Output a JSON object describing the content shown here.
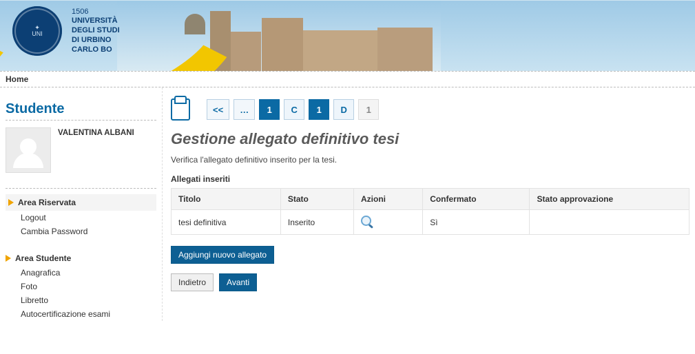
{
  "university": {
    "year": "1506",
    "line1": "UNIVERSITÀ",
    "line2": "DEGLI STUDI",
    "line3": "DI URBINO",
    "line4": "CARLO BO"
  },
  "breadcrumb": {
    "home": "Home"
  },
  "sidebar": {
    "title": "Studente",
    "user_name": "VALENTINA ALBANI",
    "area_riservata": {
      "label": "Area Riservata",
      "items": [
        "Logout",
        "Cambia Password"
      ]
    },
    "area_studente": {
      "label": "Area Studente",
      "items": [
        "Anagrafica",
        "Foto",
        "Libretto",
        "Autocertificazione esami"
      ]
    }
  },
  "wizard": {
    "back": "<<",
    "dots": "…",
    "steps": [
      "1",
      "C",
      "1",
      "D",
      "1"
    ]
  },
  "page": {
    "title": "Gestione allegato definitivo tesi",
    "desc": "Verifica l'allegato definitivo inserito per la tesi.",
    "sub": "Allegati inseriti"
  },
  "table": {
    "headers": {
      "titolo": "Titolo",
      "stato": "Stato",
      "azioni": "Azioni",
      "confermato": "Confermato",
      "approv": "Stato approvazione"
    },
    "rows": [
      {
        "titolo": "tesi definitiva",
        "stato": "Inserito",
        "confermato": "Sì",
        "approv": ""
      }
    ]
  },
  "buttons": {
    "add": "Aggiungi nuovo allegato",
    "back": "Indietro",
    "next": "Avanti"
  }
}
